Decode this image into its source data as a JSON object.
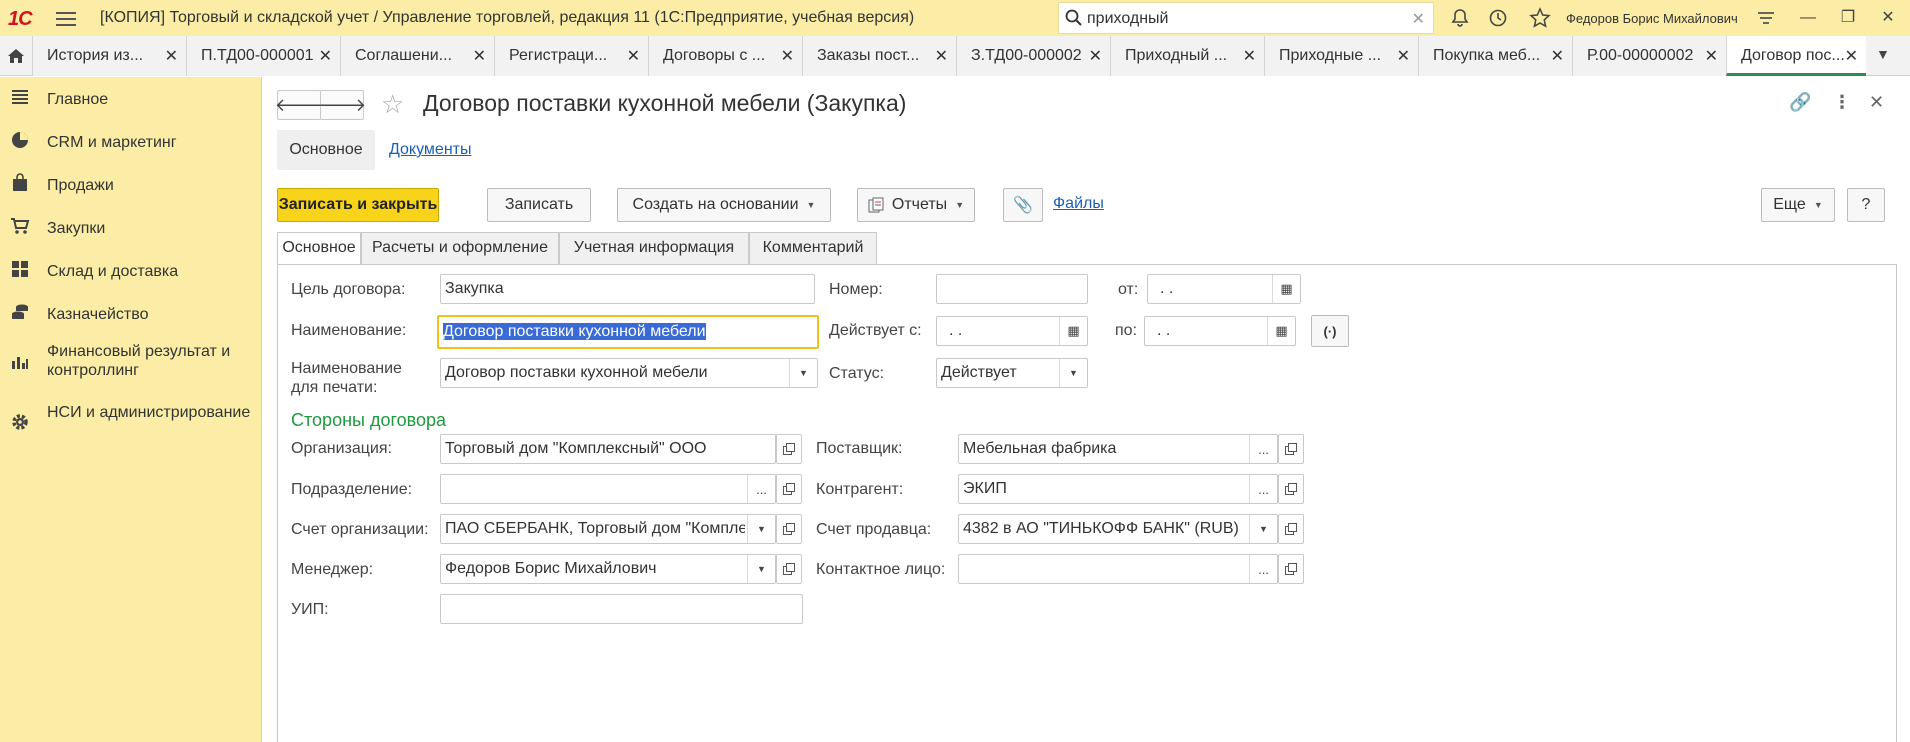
{
  "titlebar": {
    "logo": "1С",
    "app_title": "[КОПИЯ] Торговый и складской учет / Управление торговлей, редакция 11  (1С:Предприятие, учебная версия)",
    "search_value": "приходный",
    "user": "Федоров Борис Михайлович"
  },
  "tabs": [
    {
      "label": "История из..."
    },
    {
      "label": "П.ТД00-000001"
    },
    {
      "label": "Соглашени..."
    },
    {
      "label": "Регистраци..."
    },
    {
      "label": "Договоры с ..."
    },
    {
      "label": "Заказы пост..."
    },
    {
      "label": "З.ТД00-000002"
    },
    {
      "label": "Приходный ..."
    },
    {
      "label": "Приходные ..."
    },
    {
      "label": "Покупка меб..."
    },
    {
      "label": "Р.00-00000002"
    },
    {
      "label": "Договор пос..."
    }
  ],
  "sidebar": {
    "items": [
      {
        "label": "Главное",
        "icon": "menu-lines-icon"
      },
      {
        "label": "CRM и маркетинг",
        "icon": "pie-chart-icon"
      },
      {
        "label": "Продажи",
        "icon": "shopping-bag-icon"
      },
      {
        "label": "Закупки",
        "icon": "cart-icon"
      },
      {
        "label": "Склад и доставка",
        "icon": "warehouse-grid-icon"
      },
      {
        "label": "Казначейство",
        "icon": "coins-icon"
      },
      {
        "label": "Финансовый результат и контроллинг",
        "icon": "bar-chart-icon"
      },
      {
        "label": "НСИ и администрирование",
        "icon": "gear-icon"
      }
    ]
  },
  "document": {
    "title": "Договор поставки кухонной мебели (Закупка)",
    "section_tabs": {
      "main": "Основное",
      "docs": "Документы"
    },
    "toolbar": {
      "save_close": "Записать и закрыть",
      "save": "Записать",
      "create_based": "Создать на основании",
      "reports": "Отчеты",
      "files": "Файлы",
      "more": "Еще",
      "help": "?"
    },
    "inner_tabs": [
      "Основное",
      "Расчеты и оформление",
      "Учетная информация",
      "Комментарий"
    ],
    "form": {
      "purpose_label": "Цель договора:",
      "purpose_value": "Закупка",
      "number_label": "Номер:",
      "number_value": "",
      "from_label": "от:",
      "from_value": " .  .",
      "name_label": "Наименование:",
      "name_value": "Договор поставки кухонной мебели",
      "valid_from_label": "Действует с:",
      "valid_from_value": " .  .",
      "to_label": "по:",
      "to_value": " .  .",
      "print_name_label": "Наименование\nдля печати:",
      "print_name_value": "Договор поставки кухонной мебели",
      "status_label": "Статус:",
      "status_value": "Действует",
      "parties_title": "Стороны договора",
      "org_label": "Организация:",
      "org_value": "Торговый дом \"Комплексный\" ООО",
      "supplier_label": "Поставщик:",
      "supplier_value": "Мебельная фабрика",
      "dept_label": "Подразделение:",
      "dept_value": "",
      "counterparty_label": "Контрагент:",
      "counterparty_value": "ЭКИП",
      "org_account_label": "Счет организации:",
      "org_account_value": "ПАО СБЕРБАНК, Торговый дом \"Комплексный\"",
      "seller_account_label": "Счет продавца:",
      "seller_account_value": "4382 в АО \"ТИНЬКОФФ БАНК\" (RUB)",
      "manager_label": "Менеджер:",
      "manager_value": "Федоров Борис Михайлович",
      "contact_label": "Контактное лицо:",
      "contact_value": "",
      "uip_label": "УИП:",
      "uip_value": ""
    }
  },
  "colors": {
    "yellow_panel": "#fbeda5",
    "primary_button": "#f7d41a",
    "section_green": "#1f9a3e",
    "link_blue": "#1a5fb4"
  }
}
